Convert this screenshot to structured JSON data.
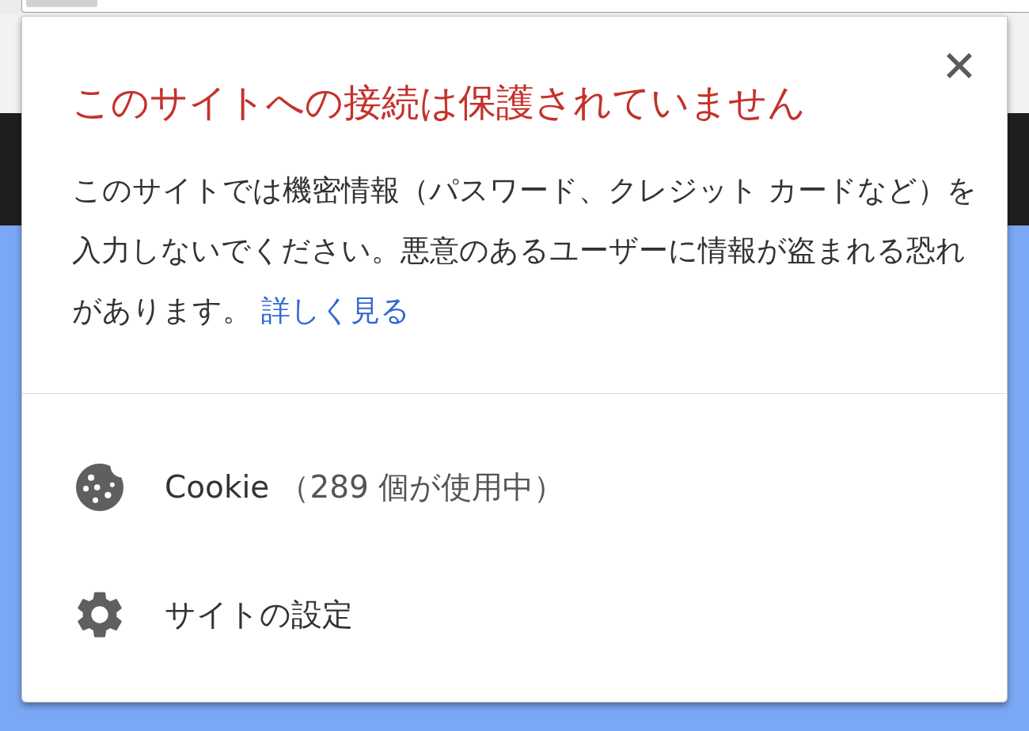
{
  "popup": {
    "warning": true,
    "title": "このサイトへの接続は保護されていません",
    "message": "このサイトでは機密情報（パスワード、クレジット カードなど）を入力しないでください。悪意のあるユーザーに情報が盗まれる恐れがあります。",
    "learn_more_link": "詳しく見る",
    "items": [
      {
        "kind": "cookies",
        "label": "Cookie",
        "detail": "（289 個が使用中）"
      },
      {
        "kind": "settings",
        "label": "サイトの設定"
      }
    ]
  }
}
